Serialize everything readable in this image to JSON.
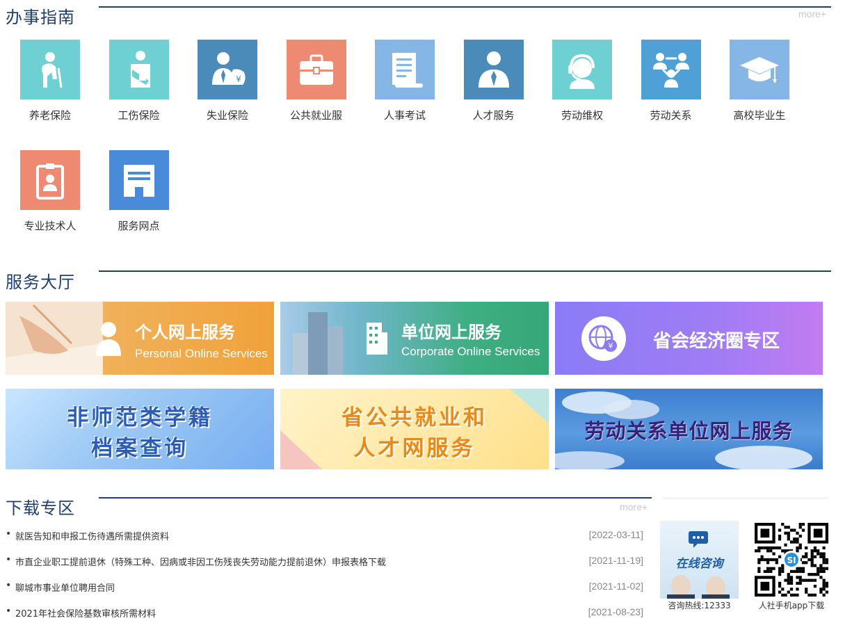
{
  "sections": {
    "guide_title": "办事指南",
    "guide_more": "more+",
    "hall_title": "服务大厅",
    "download_title": "下载专区",
    "download_more": "more+"
  },
  "guide": {
    "items": [
      {
        "label": "养老保险",
        "icon": "elderly-person-icon",
        "color": "#6fd0d4"
      },
      {
        "label": "工伤保险",
        "icon": "injured-arm-icon",
        "color": "#6fd0d4"
      },
      {
        "label": "失业保险",
        "icon": "person-money-bag-icon",
        "color": "#4a8bb9"
      },
      {
        "label": "公共就业服",
        "icon": "briefcase-icon",
        "color": "#ef8a72"
      },
      {
        "label": "人事考试",
        "icon": "exam-document-icon",
        "color": "#86b6e6"
      },
      {
        "label": "人才服务",
        "icon": "businessman-icon",
        "color": "#4a8bb9"
      },
      {
        "label": "劳动维权",
        "icon": "headset-agent-icon",
        "color": "#6fd0d4"
      },
      {
        "label": "劳动关系",
        "icon": "people-network-icon",
        "color": "#4fa0d6"
      },
      {
        "label": "高校毕业生",
        "icon": "graduation-cap-icon",
        "color": "#86b6e6"
      },
      {
        "label": "专业技术人",
        "icon": "id-badge-icon",
        "color": "#ef8a72"
      },
      {
        "label": "服务网点",
        "icon": "service-window-icon",
        "color": "#4a8bd9"
      }
    ]
  },
  "hall": {
    "personal": {
      "title": "个人网上服务",
      "subtitle": "Personal Online Services"
    },
    "corporate": {
      "title": "单位网上服务",
      "subtitle": "Corporate Online Services"
    },
    "economic": {
      "title": "省会经济圈专区"
    },
    "student": {
      "line1": "非师范类学籍",
      "line2": "档案查询"
    },
    "employment": {
      "line1": "省公共就业和",
      "line2": "人才网服务"
    },
    "labor": {
      "title": "劳动关系单位网上服务"
    }
  },
  "downloads": [
    {
      "title": "就医告知和申报工伤待遇所需提供资料",
      "date": "[2022-03-11]"
    },
    {
      "title": "市直企业职工提前退休（特殊工种、因病或非因工伤残丧失劳动能力提前退休）申报表格下载",
      "date": "[2021-11-19]"
    },
    {
      "title": "聊城市事业单位聘用合同",
      "date": "[2021-11-02]"
    },
    {
      "title": "2021年社会保险基数审核所需材料",
      "date": "[2021-08-23]"
    }
  ],
  "sidebar": {
    "consult_title": "在线咨询",
    "hotline": "咨询热线:12333",
    "app_download": "人社手机app下载"
  },
  "colors": {
    "title": "#1f3f73",
    "personal_banner": "#f0a23a",
    "corporate_banner": "#3fae82",
    "economic_banner": "#a07cf5"
  }
}
